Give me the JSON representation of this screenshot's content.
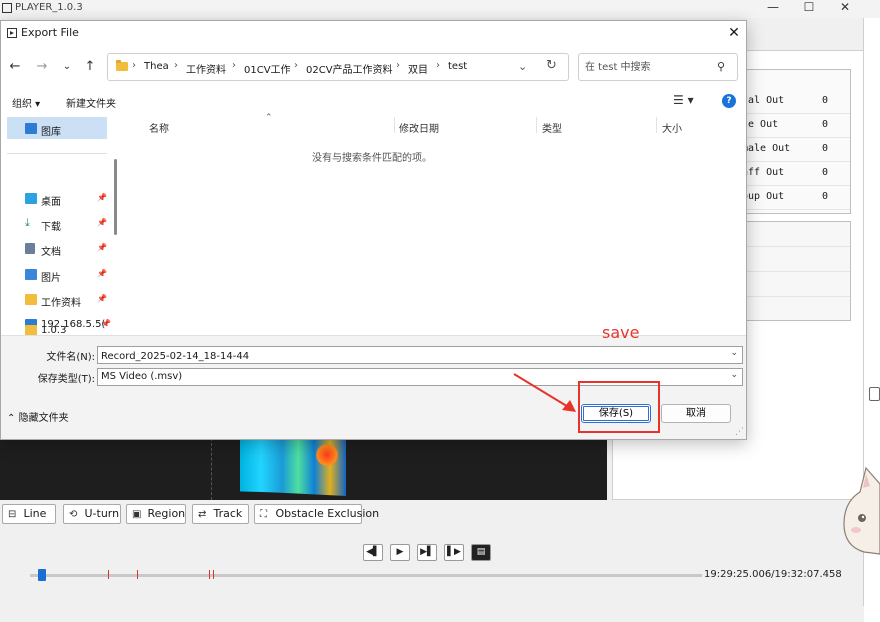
{
  "app": {
    "title": "PLAYER_1.0.3",
    "controls": {
      "minimize": "—",
      "maximize": "☐",
      "close": "✕"
    },
    "stats": [
      {
        "label": "tal Out",
        "value": "0"
      },
      {
        "label": "le Out",
        "value": "0"
      },
      {
        "label": "male Out",
        "value": "0"
      },
      {
        "label": "aff Out",
        "value": "0"
      },
      {
        "label": "oup Out",
        "value": "0"
      }
    ],
    "tools": [
      "Line",
      "U-turn",
      "Region",
      "Track",
      "Obstacle Exclusion"
    ],
    "time_readout": "19:29:25.006/19:32:07.458",
    "timeline_progress": 0.012
  },
  "dialog": {
    "title": "Export File",
    "breadcrumbs": [
      "Thea",
      "工作资料",
      "01CV工作",
      "02CV产品工作资料",
      "双目",
      "test"
    ],
    "search_placeholder": "在 test 中搜索",
    "commands": {
      "organize": "组织 ▾",
      "new_folder": "新建文件夹"
    },
    "nav_items": [
      {
        "label": "图库",
        "color": "#2e7bd6"
      },
      {
        "label": "桌面",
        "color": "#2aa3e0"
      },
      {
        "label": "下载",
        "color": "#1f8f4a"
      },
      {
        "label": "文档",
        "color": "#6b7f99"
      },
      {
        "label": "图片",
        "color": "#3a86d8"
      },
      {
        "label": "工作资料",
        "color": "#f2bd3c"
      },
      {
        "label": "192.168.5.5(",
        "color": "#2b7cd3"
      },
      {
        "label": "1.0.3",
        "color": "#f2bd3c"
      }
    ],
    "columns": [
      "名称",
      "修改日期",
      "类型",
      "大小"
    ],
    "empty_message": "没有与搜索条件匹配的项。",
    "filename_label": "文件名(N):",
    "filename_value": "Record_2025-02-14_18-14-44",
    "filetype_label": "保存类型(T):",
    "filetype_value": "MS Video (.msv)",
    "hide_folders": "隐藏文件夹",
    "save_label": "保存(S)",
    "cancel_label": "取消"
  },
  "annotation": {
    "text": "save",
    "color": "#e8332a"
  }
}
